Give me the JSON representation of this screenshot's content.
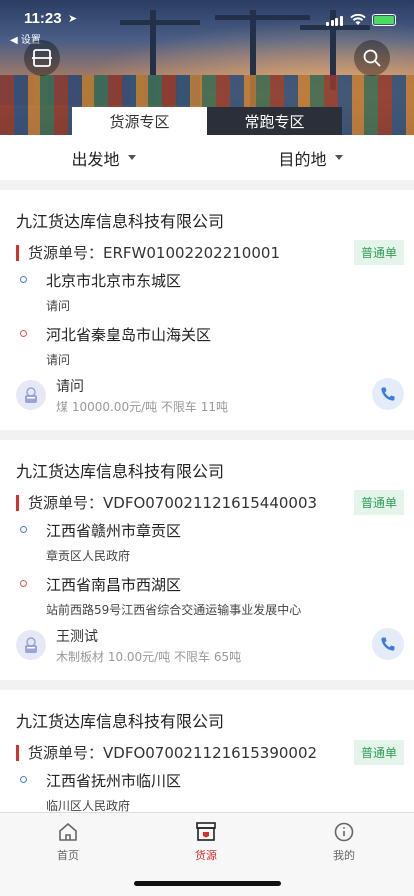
{
  "status_bar": {
    "time": "11:23",
    "back_label": "◀ 设置"
  },
  "tabs": [
    {
      "label": "货源专区",
      "active": true
    },
    {
      "label": "常跑专区",
      "active": false
    }
  ],
  "filters": {
    "origin": "出发地",
    "destination": "目的地"
  },
  "listings": [
    {
      "company": "九江货达库信息科技有限公司",
      "order_label": "货源单号：",
      "order_no": "ERFW01002202210001",
      "type_badge": "普通单",
      "from_main": "北京市北京市东城区",
      "from_sub": "请问",
      "to_main": "河北省秦皇岛市山海关区",
      "to_sub": "请问",
      "contact": "请问",
      "goods": "煤  10000.00元/吨  不限车  11吨"
    },
    {
      "company": "九江货达库信息科技有限公司",
      "order_label": "货源单号：",
      "order_no": "VDFO070021121615440003",
      "type_badge": "普通单",
      "from_main": "江西省赣州市章贡区",
      "from_sub": "章贡区人民政府",
      "to_main": "江西省南昌市西湖区",
      "to_sub": "站前西路59号江西省综合交通运输事业发展中心",
      "contact": "王测试",
      "goods": "木制板材  10.00元/吨  不限车  65吨"
    },
    {
      "company": "九江货达库信息科技有限公司",
      "order_label": "货源单号：",
      "order_no": "VDFO070021121615390002",
      "type_badge": "普通单",
      "from_main": "江西省抚州市临川区",
      "from_sub": "临川区人民政府"
    }
  ],
  "bottom_nav": [
    {
      "label": "首页",
      "icon": "home-icon",
      "active": false
    },
    {
      "label": "货源",
      "icon": "cargo-icon",
      "active": true
    },
    {
      "label": "我的",
      "icon": "profile-icon",
      "active": false
    }
  ],
  "colors": {
    "accent": "#d6302a",
    "badge_bg": "#e4f4ea",
    "badge_text": "#2f9e55",
    "phone_bg": "#e4ecfa"
  }
}
